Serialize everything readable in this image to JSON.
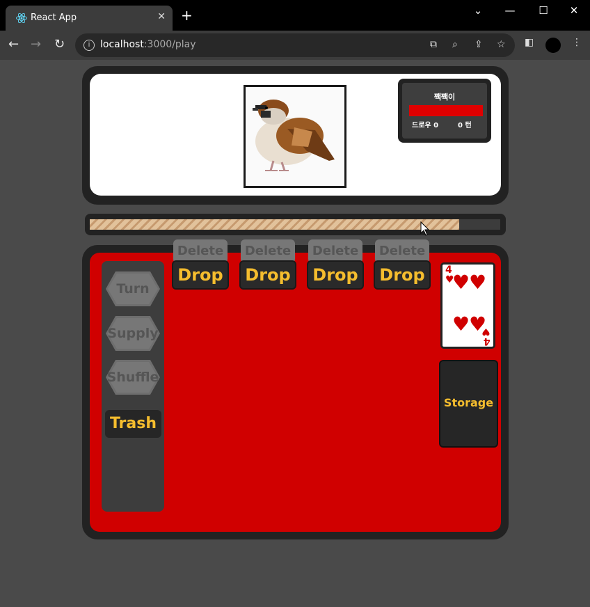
{
  "browser": {
    "tab_title": "React App",
    "tab_close": "✕",
    "new_tab": "+",
    "url_host": "localhost",
    "url_path": ":3000/play",
    "window_controls": {
      "minimize": "—",
      "maximize": "☐",
      "close": "✕"
    }
  },
  "enemy": {
    "name": "짹짹이",
    "hp_fraction": 1.0,
    "draw_label": "드로우 0",
    "turn_label": "0 턴",
    "hp_color": "#e00000"
  },
  "timer": {
    "progress": 0.9
  },
  "controls": {
    "turn": "Turn",
    "supply": "Supply",
    "shuffle": "Shuffle",
    "trash": "Trash"
  },
  "slots": [
    {
      "delete": "Delete",
      "drop": "Drop"
    },
    {
      "delete": "Delete",
      "drop": "Drop"
    },
    {
      "delete": "Delete",
      "drop": "Drop"
    },
    {
      "delete": "Delete",
      "drop": "Drop"
    }
  ],
  "card": {
    "rank": "4",
    "suit": "hearts",
    "suit_symbol": "♥"
  },
  "storage": {
    "label": "Storage"
  },
  "colors": {
    "accent": "#f5bd2e",
    "board": "#d00000",
    "panel": "#222222"
  },
  "icons": [
    "react-icon",
    "translate-icon",
    "zoom-icon",
    "share-icon",
    "star-icon",
    "sidebar-icon",
    "menu-icon"
  ]
}
